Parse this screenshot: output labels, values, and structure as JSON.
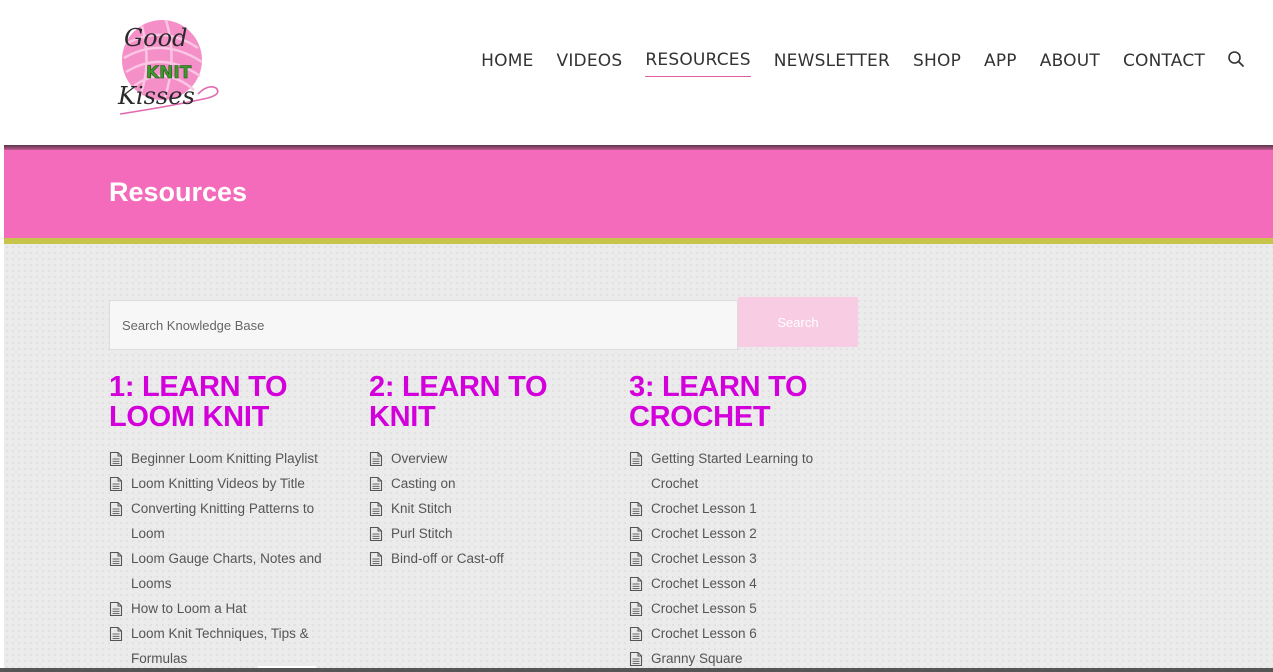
{
  "brand": {
    "logo_lines": [
      "Good",
      "KNIT",
      "Kisses"
    ]
  },
  "nav": {
    "items": [
      "HOME",
      "VIDEOS",
      "RESOURCES",
      "NEWSLETTER",
      "SHOP",
      "APP",
      "ABOUT",
      "CONTACT"
    ],
    "active": "RESOURCES"
  },
  "banner": {
    "title": "Resources"
  },
  "search": {
    "placeholder": "Search Knowledge Base",
    "value": "",
    "button_label": "Search"
  },
  "categories": [
    {
      "title": "1: LEARN TO LOOM KNIT",
      "articles": [
        "Beginner Loom Knitting Playlist",
        "Loom Knitting Videos by Title",
        "Converting Knitting Patterns to Loom",
        "Loom Gauge Charts, Notes and Looms",
        "How to Loom a Hat",
        "Loom Knit Techniques, Tips & Formulas"
      ]
    },
    {
      "title": "2: LEARN TO KNIT",
      "articles": [
        "Overview",
        "Casting on",
        "Knit Stitch",
        "Purl Stitch",
        "Bind-off or Cast-off"
      ]
    },
    {
      "title": "3: LEARN TO CROCHET",
      "articles": [
        "Getting Started Learning to Crochet",
        "Crochet Lesson 1",
        "Crochet Lesson 2",
        "Crochet Lesson 3",
        "Crochet Lesson 4",
        "Crochet Lesson 5",
        "Crochet Lesson 6",
        "Granny Square"
      ]
    }
  ],
  "colors": {
    "banner": "#f36bba",
    "banner_stripe": "#c6c44a",
    "category_title": "#d400dc",
    "search_button": "#f8cce3"
  },
  "icons": {
    "search": "magnifier-icon",
    "article": "document-icon"
  }
}
